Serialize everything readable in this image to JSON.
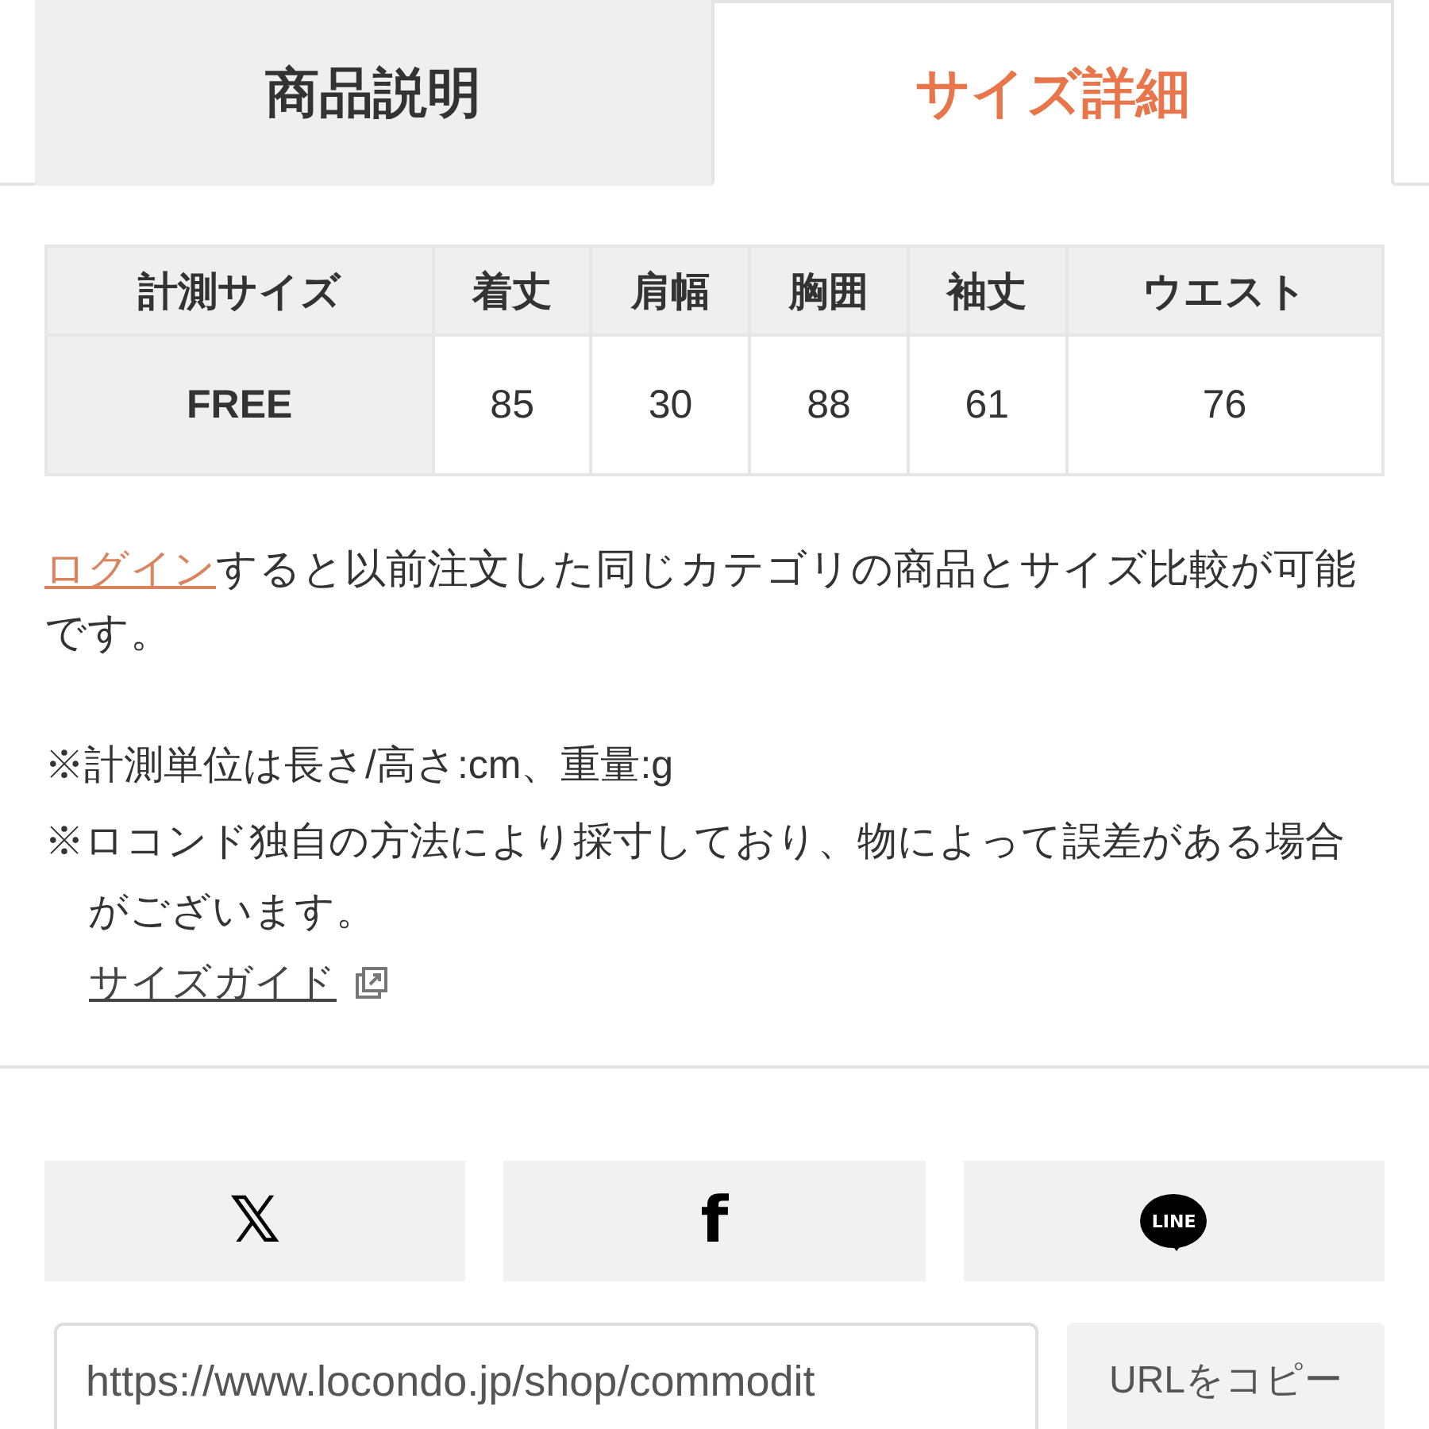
{
  "tabs": [
    {
      "label": "商品説明",
      "selected": false
    },
    {
      "label": "サイズ詳細",
      "selected": true
    }
  ],
  "size_table": {
    "columns": [
      "計測サイズ",
      "着丈",
      "肩幅",
      "胸囲",
      "袖丈",
      "ウエスト"
    ],
    "rows": [
      [
        "FREE",
        "85",
        "30",
        "88",
        "61",
        "76"
      ]
    ]
  },
  "login_note": {
    "link": "ログイン",
    "text": "すると以前注文した同じカテゴリの商品とサイズ比較が可能です。"
  },
  "notes": [
    "※計測単位は長さ/高さ:cm、重量:g",
    "※ロコンド独自の方法により採寸しており、物によって誤差がある場合がございます。"
  ],
  "size_guide_link": "サイズガイド",
  "share_buttons": [
    {
      "kind": "x",
      "label": "𝕏"
    },
    {
      "kind": "facebook",
      "label": "f"
    },
    {
      "kind": "line",
      "label": "LINE"
    }
  ],
  "url_field": {
    "value": "https://www.locondo.jp/shop/commodit"
  },
  "copy_button": "URLをコピー"
}
